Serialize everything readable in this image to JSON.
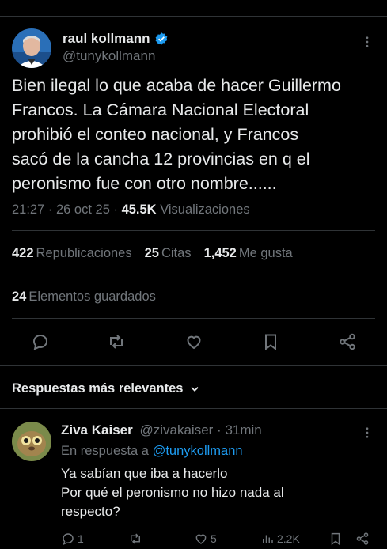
{
  "colors": {
    "background": "#000000",
    "text": "#e7e9ea",
    "muted": "#71767b",
    "link": "#1d9bf0",
    "verified": "#1d9bf0",
    "separator": "#2f3336"
  },
  "tweet": {
    "author_name": "raul kollmann",
    "handle": "@tunykollmann",
    "verified_icon": "verified-badge-icon",
    "text": "Bien ilegal lo que acaba de hacer Guillermo\nFrancos. La Cámara Nacional Electoral\nprohibió el conteo nacional, y Francos\nsacó de la cancha 12 provincias en q el\nperonismo fue con otro nombre......",
    "time": "21:27",
    "date": "26 oct 25",
    "views_count": "45.5K",
    "views_label": "Visualizaciones",
    "reposts_count": "422",
    "reposts_label": "Republicaciones",
    "quotes_count": "25",
    "quotes_label": "Citas",
    "likes_count": "1,452",
    "likes_label": "Me gusta",
    "bookmarks_count": "24",
    "bookmarks_label": "Elementos guardados",
    "actions": [
      "reply-icon",
      "retweet-icon",
      "like-icon",
      "bookmark-icon",
      "share-icon"
    ]
  },
  "replies_section": {
    "label": "Respuestas más relevantes"
  },
  "reply": {
    "author_name": "Ziva Kaiser",
    "handle": "@zivakaiser",
    "time": "31min",
    "replying_to_label": "En respuesta a",
    "replying_to_handle": "@tunykollmann",
    "line1": "Ya sabían que iba a hacerlo",
    "line2": "Por qué el peronismo no hizo nada al",
    "line3": "respecto?",
    "reply_count": "1",
    "like_count": "5",
    "views_count": "2.2K"
  }
}
